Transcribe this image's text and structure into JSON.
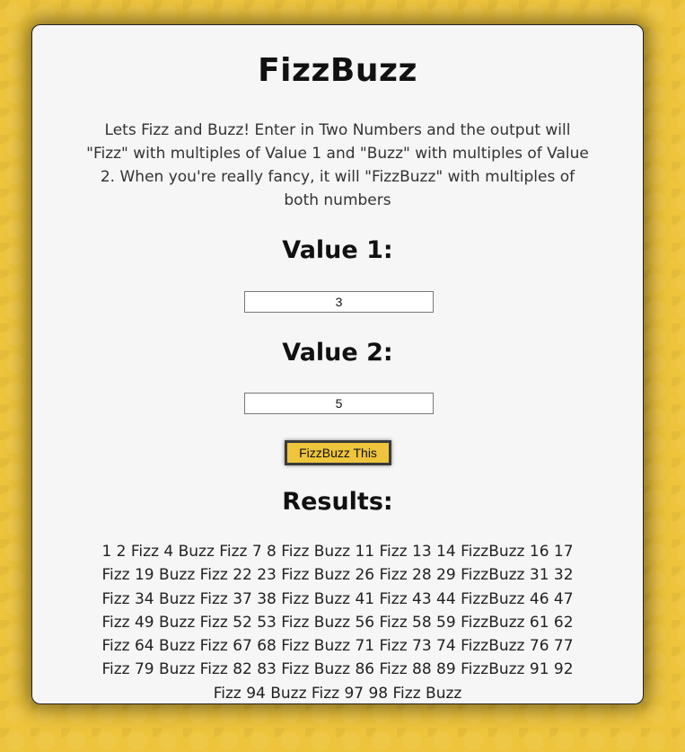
{
  "page": {
    "title": "FizzBuzz",
    "description": "Lets Fizz and Buzz! Enter in Two Numbers and the output will \"Fizz\" with multiples of Value 1 and \"Buzz\" with multiples of Value 2. When you're really fancy, it will \"FizzBuzz\" with multiples of both numbers"
  },
  "form": {
    "value1_label": "Value 1:",
    "value1": "3",
    "value2_label": "Value 2:",
    "value2": "5",
    "submit_label": "FizzBuzz This"
  },
  "results": {
    "heading": "Results:",
    "output": "1 2 Fizz 4 Buzz Fizz 7 8 Fizz Buzz 11 Fizz 13 14 FizzBuzz 16 17 Fizz 19 Buzz Fizz 22 23 Fizz Buzz 26 Fizz 28 29 FizzBuzz 31 32 Fizz 34 Buzz Fizz 37 38 Fizz Buzz 41 Fizz 43 44 FizzBuzz 46 47 Fizz 49 Buzz Fizz 52 53 Fizz Buzz 56 Fizz 58 59 FizzBuzz 61 62 Fizz 64 Buzz Fizz 67 68 Fizz Buzz 71 Fizz 73 74 FizzBuzz 76 77 Fizz 79 Buzz Fizz 82 83 Fizz Buzz 86 Fizz 88 89 FizzBuzz 91 92 Fizz 94 Buzz Fizz 97 98 Fizz Buzz"
  },
  "colors": {
    "background": "#eec43c",
    "card": "#f6f6f6",
    "button": "#eec43c"
  }
}
